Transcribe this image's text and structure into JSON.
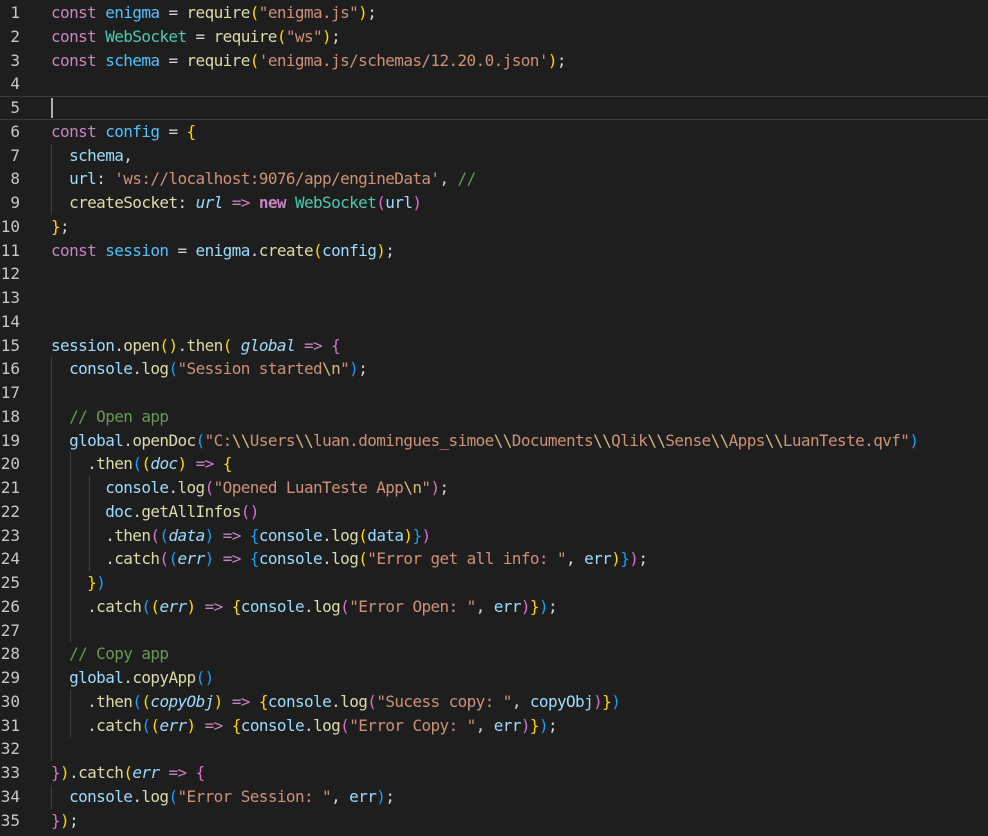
{
  "editor": {
    "active_line": 5,
    "lines": [
      {
        "n": "1",
        "segments": [
          [
            "k",
            "const "
          ],
          [
            "v",
            "enigma"
          ],
          [
            "p",
            " = "
          ],
          [
            "f",
            "require"
          ],
          [
            "b1",
            "("
          ],
          [
            "s",
            "\"enigma.js\""
          ],
          [
            "b1",
            ")"
          ],
          [
            "p",
            ";"
          ]
        ]
      },
      {
        "n": "2",
        "segments": [
          [
            "k",
            "const "
          ],
          [
            "t",
            "WebSocket"
          ],
          [
            "p",
            " = "
          ],
          [
            "f",
            "require"
          ],
          [
            "b1",
            "("
          ],
          [
            "s",
            "\"ws\""
          ],
          [
            "b1",
            ")"
          ],
          [
            "p",
            ";"
          ]
        ]
      },
      {
        "n": "3",
        "segments": [
          [
            "k",
            "const "
          ],
          [
            "v",
            "schema"
          ],
          [
            "p",
            " = "
          ],
          [
            "f",
            "require"
          ],
          [
            "b1",
            "("
          ],
          [
            "s",
            "'enigma.js/schemas/12.20.0.json'"
          ],
          [
            "b1",
            ")"
          ],
          [
            "p",
            ";"
          ]
        ]
      },
      {
        "n": "4",
        "segments": []
      },
      {
        "n": "5",
        "segments": []
      },
      {
        "n": "6",
        "segments": [
          [
            "k",
            "const "
          ],
          [
            "v",
            "config"
          ],
          [
            "p",
            " = "
          ],
          [
            "b1",
            "{"
          ]
        ]
      },
      {
        "n": "7",
        "segments": [
          [
            "p",
            "  "
          ],
          [
            "d",
            "schema"
          ],
          [
            "p",
            ","
          ]
        ]
      },
      {
        "n": "8",
        "segments": [
          [
            "p",
            "  "
          ],
          [
            "d",
            "url"
          ],
          [
            "p",
            ": "
          ],
          [
            "s",
            "'ws://localhost:9076/app/engineData'"
          ],
          [
            "p",
            ", "
          ],
          [
            "c",
            "//"
          ]
        ]
      },
      {
        "n": "9",
        "segments": [
          [
            "p",
            "  "
          ],
          [
            "f",
            "createSocket"
          ],
          [
            "p",
            ": "
          ],
          [
            "pi",
            "url"
          ],
          [
            "k",
            " => "
          ],
          [
            "kw",
            "new "
          ],
          [
            "t",
            "WebSocket"
          ],
          [
            "b2",
            "("
          ],
          [
            "d",
            "url"
          ],
          [
            "b2",
            ")"
          ]
        ]
      },
      {
        "n": "10",
        "segments": [
          [
            "b1",
            "}"
          ],
          [
            "p",
            ";"
          ]
        ]
      },
      {
        "n": "11",
        "segments": [
          [
            "k",
            "const "
          ],
          [
            "v",
            "session"
          ],
          [
            "p",
            " = "
          ],
          [
            "d",
            "enigma"
          ],
          [
            "p",
            "."
          ],
          [
            "f",
            "create"
          ],
          [
            "b1",
            "("
          ],
          [
            "d",
            "config"
          ],
          [
            "b1",
            ")"
          ],
          [
            "p",
            ";"
          ]
        ]
      },
      {
        "n": "12",
        "segments": []
      },
      {
        "n": "13",
        "segments": []
      },
      {
        "n": "14",
        "segments": []
      },
      {
        "n": "15",
        "segments": [
          [
            "d",
            "session"
          ],
          [
            "p",
            "."
          ],
          [
            "f",
            "open"
          ],
          [
            "b1",
            "()"
          ],
          [
            "p",
            "."
          ],
          [
            "f",
            "then"
          ],
          [
            "b1",
            "("
          ],
          [
            "p",
            " "
          ],
          [
            "pi",
            "global"
          ],
          [
            "k",
            " => "
          ],
          [
            "b2",
            "{"
          ]
        ]
      },
      {
        "n": "16",
        "segments": [
          [
            "p",
            "  "
          ],
          [
            "d",
            "console"
          ],
          [
            "p",
            "."
          ],
          [
            "f",
            "log"
          ],
          [
            "b3",
            "("
          ],
          [
            "s",
            "\"Session started"
          ],
          [
            "esc",
            "\\n"
          ],
          [
            "s",
            "\""
          ],
          [
            "b3",
            ")"
          ],
          [
            "p",
            ";"
          ]
        ]
      },
      {
        "n": "17",
        "segments": []
      },
      {
        "n": "18",
        "segments": [
          [
            "p",
            "  "
          ],
          [
            "c",
            "// Open app"
          ]
        ]
      },
      {
        "n": "19",
        "segments": [
          [
            "p",
            "  "
          ],
          [
            "d",
            "global"
          ],
          [
            "p",
            "."
          ],
          [
            "f",
            "openDoc"
          ],
          [
            "b3",
            "("
          ],
          [
            "s",
            "\"C:"
          ],
          [
            "esc",
            "\\\\"
          ],
          [
            "s",
            "Users"
          ],
          [
            "esc",
            "\\\\"
          ],
          [
            "s",
            "luan.domingues_simoe"
          ],
          [
            "esc",
            "\\\\"
          ],
          [
            "s",
            "Documents"
          ],
          [
            "esc",
            "\\\\"
          ],
          [
            "s",
            "Qlik"
          ],
          [
            "esc",
            "\\\\"
          ],
          [
            "s",
            "Sense"
          ],
          [
            "esc",
            "\\\\"
          ],
          [
            "s",
            "Apps"
          ],
          [
            "esc",
            "\\\\"
          ],
          [
            "s",
            "LuanTeste.qvf\""
          ],
          [
            "b3",
            ")"
          ]
        ]
      },
      {
        "n": "20",
        "segments": [
          [
            "p",
            "    ."
          ],
          [
            "f",
            "then"
          ],
          [
            "b3",
            "("
          ],
          [
            "b1",
            "("
          ],
          [
            "pi",
            "doc"
          ],
          [
            "b1",
            ")"
          ],
          [
            "k",
            " => "
          ],
          [
            "b1",
            "{"
          ]
        ]
      },
      {
        "n": "21",
        "segments": [
          [
            "p",
            "      "
          ],
          [
            "d",
            "console"
          ],
          [
            "p",
            "."
          ],
          [
            "f",
            "log"
          ],
          [
            "b2",
            "("
          ],
          [
            "s",
            "\"Opened LuanTeste App"
          ],
          [
            "esc",
            "\\n"
          ],
          [
            "s",
            "\""
          ],
          [
            "b2",
            ")"
          ],
          [
            "p",
            ";"
          ]
        ]
      },
      {
        "n": "22",
        "segments": [
          [
            "p",
            "      "
          ],
          [
            "d",
            "doc"
          ],
          [
            "p",
            "."
          ],
          [
            "f",
            "getAllInfos"
          ],
          [
            "b2",
            "()"
          ]
        ]
      },
      {
        "n": "23",
        "segments": [
          [
            "p",
            "      ."
          ],
          [
            "f",
            "then"
          ],
          [
            "b2",
            "("
          ],
          [
            "b3",
            "("
          ],
          [
            "pi",
            "data"
          ],
          [
            "b3",
            ")"
          ],
          [
            "k",
            " => "
          ],
          [
            "b3",
            "{"
          ],
          [
            "d",
            "console"
          ],
          [
            "p",
            "."
          ],
          [
            "f",
            "log"
          ],
          [
            "b1",
            "("
          ],
          [
            "d",
            "data"
          ],
          [
            "b1",
            ")"
          ],
          [
            "b3",
            "}"
          ],
          [
            "b2",
            ")"
          ]
        ]
      },
      {
        "n": "24",
        "segments": [
          [
            "p",
            "      ."
          ],
          [
            "f",
            "catch"
          ],
          [
            "b2",
            "("
          ],
          [
            "b3",
            "("
          ],
          [
            "pi",
            "err"
          ],
          [
            "b3",
            ")"
          ],
          [
            "k",
            " => "
          ],
          [
            "b3",
            "{"
          ],
          [
            "d",
            "console"
          ],
          [
            "p",
            "."
          ],
          [
            "f",
            "log"
          ],
          [
            "b1",
            "("
          ],
          [
            "s",
            "\"Error get all info: \""
          ],
          [
            "p",
            ", "
          ],
          [
            "d",
            "err"
          ],
          [
            "b1",
            ")"
          ],
          [
            "b3",
            "}"
          ],
          [
            "b2",
            ")"
          ],
          [
            "p",
            ";"
          ]
        ]
      },
      {
        "n": "25",
        "segments": [
          [
            "p",
            "    "
          ],
          [
            "b1",
            "}"
          ],
          [
            "b3",
            ")"
          ]
        ]
      },
      {
        "n": "26",
        "segments": [
          [
            "p",
            "    ."
          ],
          [
            "f",
            "catch"
          ],
          [
            "b3",
            "("
          ],
          [
            "b1",
            "("
          ],
          [
            "pi",
            "err"
          ],
          [
            "b1",
            ")"
          ],
          [
            "k",
            " => "
          ],
          [
            "b1",
            "{"
          ],
          [
            "d",
            "console"
          ],
          [
            "p",
            "."
          ],
          [
            "f",
            "log"
          ],
          [
            "b2",
            "("
          ],
          [
            "s",
            "\"Error Open: \""
          ],
          [
            "p",
            ", "
          ],
          [
            "d",
            "err"
          ],
          [
            "b2",
            ")"
          ],
          [
            "b1",
            "}"
          ],
          [
            "b3",
            ")"
          ],
          [
            "p",
            ";"
          ]
        ]
      },
      {
        "n": "27",
        "segments": []
      },
      {
        "n": "28",
        "segments": [
          [
            "p",
            "  "
          ],
          [
            "c",
            "// Copy app"
          ]
        ]
      },
      {
        "n": "29",
        "segments": [
          [
            "p",
            "  "
          ],
          [
            "d",
            "global"
          ],
          [
            "p",
            "."
          ],
          [
            "f",
            "copyApp"
          ],
          [
            "b3",
            "()"
          ]
        ]
      },
      {
        "n": "30",
        "segments": [
          [
            "p",
            "    ."
          ],
          [
            "f",
            "then"
          ],
          [
            "b3",
            "("
          ],
          [
            "b1",
            "("
          ],
          [
            "pi",
            "copyObj"
          ],
          [
            "b1",
            ")"
          ],
          [
            "k",
            " => "
          ],
          [
            "b1",
            "{"
          ],
          [
            "d",
            "console"
          ],
          [
            "p",
            "."
          ],
          [
            "f",
            "log"
          ],
          [
            "b2",
            "("
          ],
          [
            "s",
            "\"Sucess copy: \""
          ],
          [
            "p",
            ", "
          ],
          [
            "d",
            "copyObj"
          ],
          [
            "b2",
            ")"
          ],
          [
            "b1",
            "}"
          ],
          [
            "b3",
            ")"
          ]
        ]
      },
      {
        "n": "31",
        "segments": [
          [
            "p",
            "    ."
          ],
          [
            "f",
            "catch"
          ],
          [
            "b3",
            "("
          ],
          [
            "b1",
            "("
          ],
          [
            "pi",
            "err"
          ],
          [
            "b1",
            ")"
          ],
          [
            "k",
            " => "
          ],
          [
            "b1",
            "{"
          ],
          [
            "d",
            "console"
          ],
          [
            "p",
            "."
          ],
          [
            "f",
            "log"
          ],
          [
            "b2",
            "("
          ],
          [
            "s",
            "\"Error Copy: \""
          ],
          [
            "p",
            ", "
          ],
          [
            "d",
            "err"
          ],
          [
            "b2",
            ")"
          ],
          [
            "b1",
            "}"
          ],
          [
            "b3",
            ")"
          ],
          [
            "p",
            ";"
          ]
        ]
      },
      {
        "n": "32",
        "segments": []
      },
      {
        "n": "33",
        "segments": [
          [
            "b2",
            "}"
          ],
          [
            "b1",
            ")"
          ],
          [
            "p",
            "."
          ],
          [
            "f",
            "catch"
          ],
          [
            "b1",
            "("
          ],
          [
            "pi",
            "err"
          ],
          [
            "k",
            " => "
          ],
          [
            "b2",
            "{"
          ]
        ]
      },
      {
        "n": "34",
        "segments": [
          [
            "p",
            "  "
          ],
          [
            "d",
            "console"
          ],
          [
            "p",
            "."
          ],
          [
            "f",
            "log"
          ],
          [
            "b3",
            "("
          ],
          [
            "s",
            "\"Error Session: \""
          ],
          [
            "p",
            ", "
          ],
          [
            "d",
            "err"
          ],
          [
            "b3",
            ")"
          ],
          [
            "p",
            ";"
          ]
        ]
      },
      {
        "n": "35",
        "segments": [
          [
            "b2",
            "}"
          ],
          [
            "b1",
            ")"
          ],
          [
            "p",
            ";"
          ]
        ]
      }
    ]
  }
}
